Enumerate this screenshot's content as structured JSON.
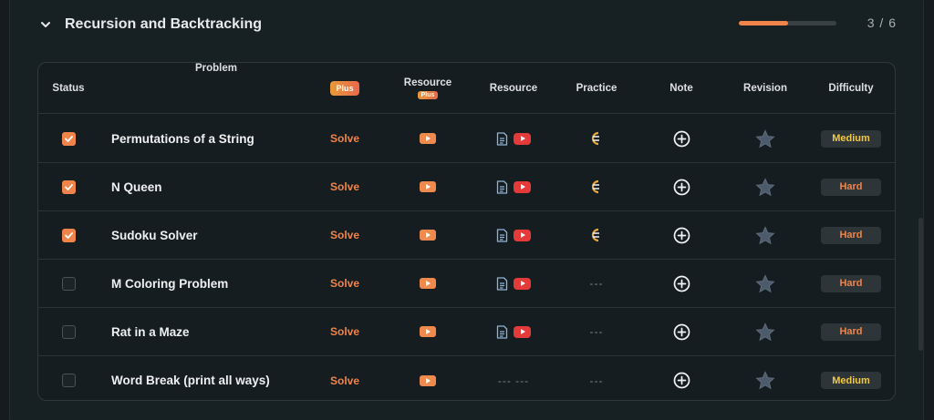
{
  "section": {
    "title": "Recursion and Backtracking",
    "progress_fraction": 0.5,
    "count": "3 / 6",
    "icon": "chevron-down-icon"
  },
  "headers": {
    "status": "Status",
    "problem": "Problem",
    "plus": "Plus",
    "resource_plus": "Resource",
    "resource_plus_badge": "Plus",
    "resource": "Resource",
    "practice": "Practice",
    "note": "Note",
    "revision": "Revision",
    "difficulty": "Difficulty"
  },
  "colors": {
    "accent": "#f0844a",
    "youtube": "#e53a3a",
    "medium": "#f0c94a",
    "hard": "#f0844a"
  },
  "rows": [
    {
      "checked": true,
      "problem": "Permutations of a String",
      "solve": "Solve",
      "article": true,
      "video": true,
      "practice": "codestudio",
      "practice_text": "",
      "difficulty": "Medium",
      "level": "medium"
    },
    {
      "checked": true,
      "problem": "N Queen",
      "solve": "Solve",
      "article": true,
      "video": true,
      "practice": "codestudio",
      "practice_text": "",
      "difficulty": "Hard",
      "level": "hard"
    },
    {
      "checked": true,
      "problem": "Sudoku Solver",
      "solve": "Solve",
      "article": true,
      "video": true,
      "practice": "codestudio",
      "practice_text": "",
      "difficulty": "Hard",
      "level": "hard"
    },
    {
      "checked": false,
      "problem": "M Coloring Problem",
      "solve": "Solve",
      "article": true,
      "video": true,
      "practice": "none",
      "practice_text": "---",
      "difficulty": "Hard",
      "level": "hard"
    },
    {
      "checked": false,
      "problem": "Rat in a Maze",
      "solve": "Solve",
      "article": true,
      "video": true,
      "practice": "none",
      "practice_text": "---",
      "difficulty": "Hard",
      "level": "hard"
    },
    {
      "checked": false,
      "problem": "Word Break (print all ways)",
      "solve": "Solve",
      "article": false,
      "video": false,
      "resource_text": "---   ---",
      "practice": "none",
      "practice_text": "---",
      "difficulty": "Medium",
      "level": "medium"
    }
  ]
}
